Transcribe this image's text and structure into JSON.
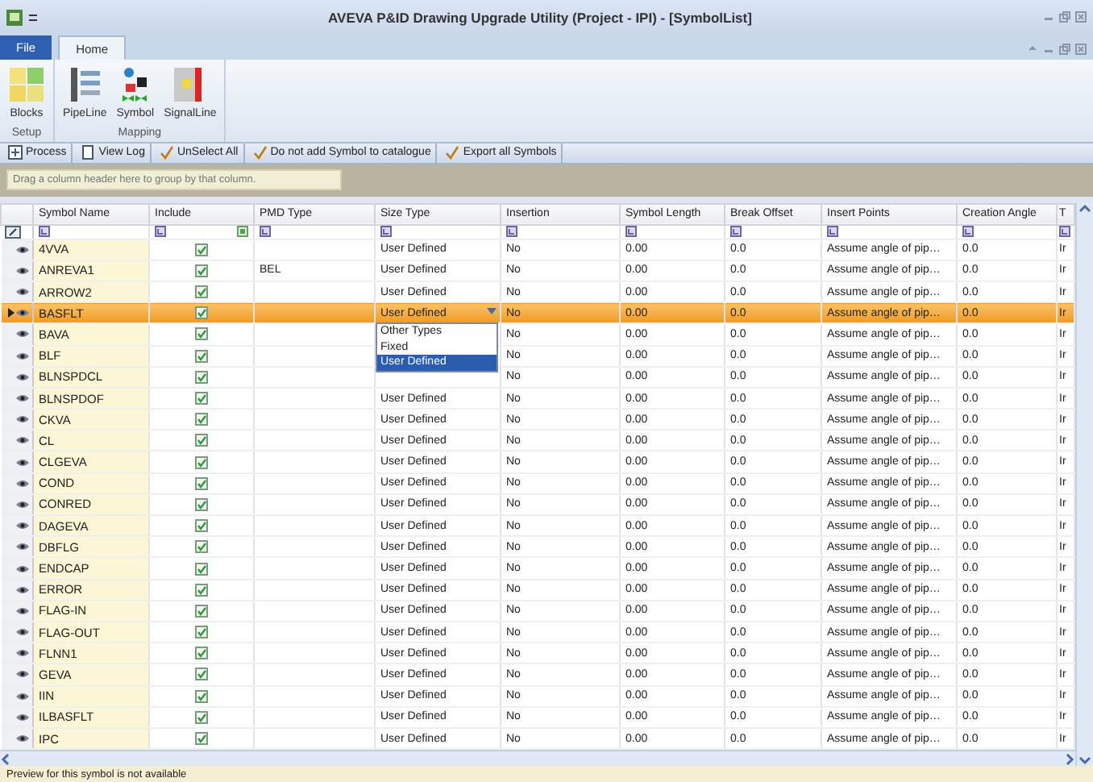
{
  "window": {
    "title": "AVEVA P&ID Drawing Upgrade Utility (Project - IPI) - [SymbolList]"
  },
  "ribbon": {
    "tabs": [
      {
        "label": "File",
        "kind": "file",
        "selected": false
      },
      {
        "label": "Home",
        "kind": "tab",
        "selected": true
      }
    ],
    "groups": [
      {
        "label": "Setup",
        "buttons": [
          {
            "label": "Blocks",
            "kind": "blocks"
          }
        ]
      },
      {
        "label": "Mapping",
        "buttons": [
          {
            "label": "PipeLine",
            "kind": "pipeline"
          },
          {
            "label": "Symbol",
            "kind": "symbol"
          },
          {
            "label": "SignalLine",
            "kind": "signalline"
          }
        ]
      }
    ]
  },
  "toolbar": [
    {
      "label": "Process",
      "kind": "process"
    },
    {
      "label": "View Log",
      "kind": "log"
    },
    {
      "label": "UnSelect All",
      "kind": "tick"
    },
    {
      "label": "Do not add Symbol to catalogue",
      "kind": "tick"
    },
    {
      "label": "Export all Symbols",
      "kind": "tick"
    }
  ],
  "group_panel": {
    "placeholder": "Drag a column header here to group by that column."
  },
  "table": {
    "columns": [
      "Symbol Name",
      "Include",
      "PMD Type",
      "Size Type",
      "Insertion",
      "Symbol Length",
      "Break Offset",
      "Insert Points",
      "Creation Angle",
      "T"
    ],
    "rows": [
      {
        "symbol_name": "4VVA",
        "include": true,
        "size_type": "User Defined",
        "insertion": "No",
        "symbol_length": "0.00",
        "break_value": "0.0",
        "insert_points": "Assume angle of pip…",
        "creation_angle": "0.0",
        "column_11": "Ir",
        "selected": false
      },
      {
        "symbol_name": "ANREVA1",
        "include": true,
        "pmd_type": "BEL",
        "size_type": "User Defined",
        "insertion": "No",
        "symbol_length": "0.00",
        "break_value": "0.0",
        "insert_points": "Assume angle of pip…",
        "creation_angle": "0.0",
        "column_11": "Ir",
        "selected": false
      },
      {
        "symbol_name": "ARROW2",
        "include": true,
        "size_type": "User Defined",
        "insertion": "No",
        "symbol_length": "0.00",
        "break_value": "0.0",
        "insert_points": "Assume angle of pip…",
        "creation_angle": "0.0",
        "column_11": "Ir",
        "selected": false
      },
      {
        "symbol_name": "BASFLT",
        "include": true,
        "size_type": "User Defined",
        "size_type_options": [
          {
            "label": "Other Types",
            "selected": false
          },
          {
            "label": "Fixed",
            "selected": false
          },
          {
            "label": "User Defined",
            "selected": true
          }
        ],
        "insertion": "No",
        "symbol_length": "0.00",
        "break_value": "0.0",
        "insert_points": "Assume angle of pip…",
        "creation_angle": "0.0",
        "column_11": "Ir",
        "selected": true
      },
      {
        "symbol_name": "BAVA",
        "include": true,
        "insertion": "No",
        "symbol_length": "0.00",
        "break_value": "0.0",
        "insert_points": "Assume angle of pip…",
        "creation_angle": "0.0",
        "column_11": "Ir",
        "selected": false
      },
      {
        "symbol_name": "BLF",
        "include": true,
        "insertion": "No",
        "symbol_length": "0.00",
        "break_value": "0.0",
        "insert_points": "Assume angle of pip…",
        "creation_angle": "0.0",
        "column_11": "Ir",
        "selected": false
      },
      {
        "symbol_name": "BLNSPDCL",
        "include": true,
        "insertion": "No",
        "symbol_length": "0.00",
        "break_value": "0.0",
        "insert_points": "Assume angle of pip…",
        "creation_angle": "0.0",
        "column_11": "Ir",
        "selected": false
      },
      {
        "symbol_name": "BLNSPDOF",
        "include": true,
        "size_type": "User Defined",
        "insertion": "No",
        "symbol_length": "0.00",
        "break_value": "0.0",
        "insert_points": "Assume angle of pip…",
        "creation_angle": "0.0",
        "column_11": "Ir",
        "selected": false
      },
      {
        "symbol_name": "CKVA",
        "include": true,
        "size_type": "User Defined",
        "insertion": "No",
        "symbol_length": "0.00",
        "break_value": "0.0",
        "insert_points": "Assume angle of pip…",
        "creation_angle": "0.0",
        "column_11": "Ir",
        "selected": false
      },
      {
        "symbol_name": "CL",
        "include": true,
        "size_type": "User Defined",
        "insertion": "No",
        "symbol_length": "0.00",
        "break_value": "0.0",
        "insert_points": "Assume angle of pip…",
        "creation_angle": "0.0",
        "column_11": "Ir",
        "selected": false
      },
      {
        "symbol_name": "CLGEVA",
        "include": true,
        "size_type": "User Defined",
        "insertion": "No",
        "symbol_length": "0.00",
        "break_value": "0.0",
        "insert_points": "Assume angle of pip…",
        "creation_angle": "0.0",
        "column_11": "Ir",
        "selected": false
      },
      {
        "symbol_name": "COND",
        "include": true,
        "size_type": "User Defined",
        "insertion": "No",
        "symbol_length": "0.00",
        "break_value": "0.0",
        "insert_points": "Assume angle of pip…",
        "creation_angle": "0.0",
        "column_11": "Ir",
        "selected": false
      },
      {
        "symbol_name": "CONRED",
        "include": true,
        "size_type": "User Defined",
        "insertion": "No",
        "symbol_length": "0.00",
        "break_value": "0.0",
        "insert_points": "Assume angle of pip…",
        "creation_angle": "0.0",
        "column_11": "Ir",
        "selected": false
      },
      {
        "symbol_name": "DAGEVA",
        "include": true,
        "size_type": "User Defined",
        "insertion": "No",
        "symbol_length": "0.00",
        "break_value": "0.0",
        "insert_points": "Assume angle of pip…",
        "creation_angle": "0.0",
        "column_11": "Ir",
        "selected": false
      },
      {
        "symbol_name": "DBFLG",
        "include": true,
        "size_type": "User Defined",
        "insertion": "No",
        "symbol_length": "0.00",
        "break_value": "0.0",
        "insert_points": "Assume angle of pip…",
        "creation_angle": "0.0",
        "column_11": "Ir",
        "selected": false
      },
      {
        "symbol_name": "ENDCAP",
        "include": true,
        "size_type": "User Defined",
        "insertion": "No",
        "symbol_length": "0.00",
        "break_value": "0.0",
        "insert_points": "Assume angle of pip…",
        "creation_angle": "0.0",
        "column_11": "Ir",
        "selected": false
      },
      {
        "symbol_name": "ERROR",
        "include": true,
        "size_type": "User Defined",
        "insertion": "No",
        "symbol_length": "0.00",
        "break_value": "0.0",
        "insert_points": "Assume angle of pip…",
        "creation_angle": "0.0",
        "column_11": "Ir",
        "selected": false
      },
      {
        "symbol_name": "FLAG-IN",
        "include": true,
        "size_type": "User Defined",
        "insertion": "No",
        "symbol_length": "0.00",
        "break_value": "0.0",
        "insert_points": "Assume angle of pip…",
        "creation_angle": "0.0",
        "column_11": "Ir",
        "selected": false
      },
      {
        "symbol_name": "FLAG-OUT",
        "include": true,
        "size_type": "User Defined",
        "insertion": "No",
        "symbol_length": "0.00",
        "break_value": "0.0",
        "insert_points": "Assume angle of pip…",
        "creation_angle": "0.0",
        "column_11": "Ir",
        "selected": false
      },
      {
        "symbol_name": "FLNN1",
        "include": true,
        "size_type": "User Defined",
        "insertion": "No",
        "symbol_length": "0.00",
        "break_value": "0.0",
        "insert_points": "Assume angle of pip…",
        "creation_angle": "0.0",
        "column_11": "Ir",
        "selected": false
      },
      {
        "symbol_name": "GEVA",
        "include": true,
        "size_type": "User Defined",
        "insertion": "No",
        "symbol_length": "0.00",
        "break_value": "0.0",
        "insert_points": "Assume angle of pip…",
        "creation_angle": "0.0",
        "column_11": "Ir",
        "selected": false
      },
      {
        "symbol_name": "IIN",
        "include": true,
        "size_type": "User Defined",
        "insertion": "No",
        "symbol_length": "0.00",
        "break_value": "0.0",
        "insert_points": "Assume angle of pip…",
        "creation_angle": "0.0",
        "column_11": "Ir",
        "selected": false
      },
      {
        "symbol_name": "ILBASFLT",
        "include": true,
        "size_type": "User Defined",
        "insertion": "No",
        "symbol_length": "0.00",
        "break_value": "0.0",
        "insert_points": "Assume angle of pip…",
        "creation_angle": "0.0",
        "column_11": "Ir",
        "selected": false
      },
      {
        "symbol_name": "IPC",
        "include": true,
        "size_type": "User Defined",
        "insertion": "No",
        "symbol_length": "0.00",
        "break_value": "0.0",
        "insert_points": "Assume angle of pip…",
        "creation_angle": "0.0",
        "column_11": "Ir",
        "selected": false
      }
    ]
  },
  "status_bar": {
    "text": "Preview for this symbol is not available"
  }
}
